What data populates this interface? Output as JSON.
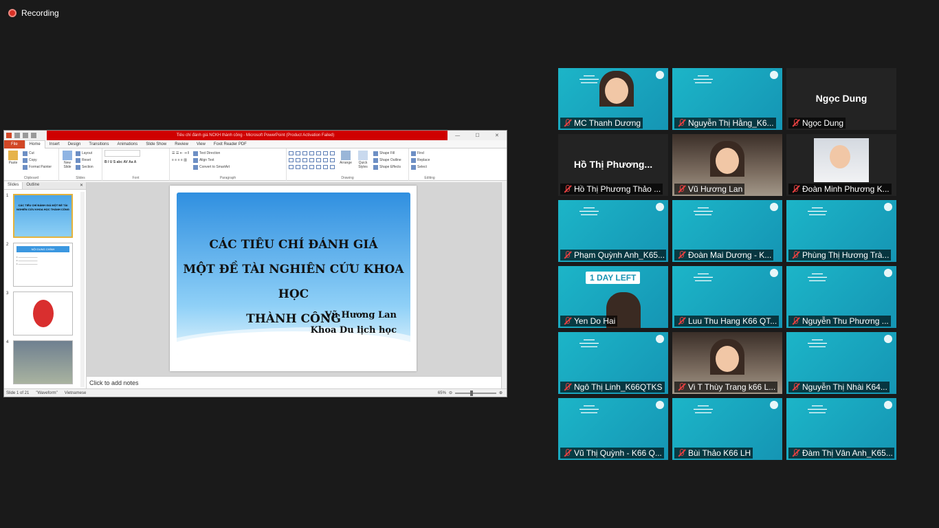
{
  "recording": {
    "label": "Recording"
  },
  "ppt": {
    "window_title": "Tiêu chí đánh giá NCKH thành công  -  Microsoft PowerPoint (Product Activation Failed)",
    "tabs": [
      "File",
      "Home",
      "Insert",
      "Design",
      "Transitions",
      "Animations",
      "Slide Show",
      "Review",
      "View",
      "Foxit Reader PDF"
    ],
    "active_tab": "Home",
    "groups": {
      "clipboard": {
        "label": "Clipboard",
        "paste": "Paste",
        "cut": "Cut",
        "copy": "Copy",
        "format_painter": "Format Painter"
      },
      "slides": {
        "label": "Slides",
        "new_slide": "New Slide",
        "layout": "Layout",
        "reset": "Reset",
        "section": "Section"
      },
      "font": {
        "label": "Font"
      },
      "paragraph": {
        "label": "Paragraph",
        "text_direction": "Text Direction",
        "align_text": "Align Text",
        "convert": "Convert to SmartArt"
      },
      "drawing": {
        "label": "Drawing",
        "arrange": "Arrange",
        "quick_styles": "Quick Styles",
        "shape_fill": "Shape Fill",
        "shape_outline": "Shape Outline",
        "shape_effects": "Shape Effects"
      },
      "editing": {
        "label": "Editing",
        "find": "Find",
        "replace": "Replace",
        "select": "Select"
      }
    },
    "panel_tabs": {
      "slides": "Slides",
      "outline": "Outline"
    },
    "thumbnails": [
      {
        "num": "1",
        "text": "CÁC TIÊU CHÍ ĐÁNH GIÁ MỘT ĐỀ TÀI NGHIÊN CỨU KHOA HỌC THÀNH CÔNG"
      },
      {
        "num": "2",
        "text": "NỘI DUNG CHÍNH"
      },
      {
        "num": "3",
        "text": ""
      },
      {
        "num": "4",
        "text": ""
      }
    ],
    "slide": {
      "title_line1": "CÁC TIÊU CHÍ ĐÁNH GIÁ",
      "title_line2": "MỘT ĐỀ TÀI NGHIÊN CỨU KHOA HỌC",
      "title_line3": "THÀNH CÔNG",
      "author": "Vũ Hương Lan",
      "department": "Khoa Du lịch học"
    },
    "notes_placeholder": "Click to add notes",
    "status": {
      "slide": "Slide 1 of 21",
      "theme": "\"Waveform\"",
      "language": "Vietnamese",
      "zoom": "65%"
    }
  },
  "participants": [
    {
      "name": "MC Thanh Dương",
      "type": "video-poster"
    },
    {
      "name": "Nguyễn Thị Hằng_K6...",
      "type": "poster"
    },
    {
      "name": "Ngọc Dung",
      "type": "name",
      "display": "Ngọc Dung"
    },
    {
      "name": "Hồ Thị Phương Thảo ...",
      "type": "name",
      "display": "Hồ Thị Phương..."
    },
    {
      "name": "Vũ Hương Lan",
      "type": "video",
      "active": true
    },
    {
      "name": "Đoàn Minh Phương K...",
      "type": "photo"
    },
    {
      "name": "Phạm Quỳnh Anh_K65...",
      "type": "poster"
    },
    {
      "name": "Đoàn Mai Dương - K...",
      "type": "poster"
    },
    {
      "name": "Phùng Thị Hương Trà...",
      "type": "poster"
    },
    {
      "name": "Yen Do Hai",
      "type": "dayleft",
      "badge": "1 DAY LEFT"
    },
    {
      "name": "Luu Thu Hang K66 QT...",
      "type": "poster"
    },
    {
      "name": "Nguyễn Thu Phương ...",
      "type": "poster"
    },
    {
      "name": "Ngô Thị Linh_K66QTKS",
      "type": "poster"
    },
    {
      "name": "Vi T Thùy Trang k66 L...",
      "type": "video"
    },
    {
      "name": "Nguyễn Thị Nhài K64...",
      "type": "poster"
    },
    {
      "name": "Vũ Thị Quỳnh - K66 Q...",
      "type": "poster"
    },
    {
      "name": "Bùi Thảo K66 LH",
      "type": "poster"
    },
    {
      "name": "Đàm Thị Vân Anh_K65...",
      "type": "poster"
    }
  ],
  "colors": {
    "recording": "#d93025",
    "teal": "#1aa8c4",
    "active_border": "#e8e84c",
    "ppt_title": "#cf0000"
  }
}
